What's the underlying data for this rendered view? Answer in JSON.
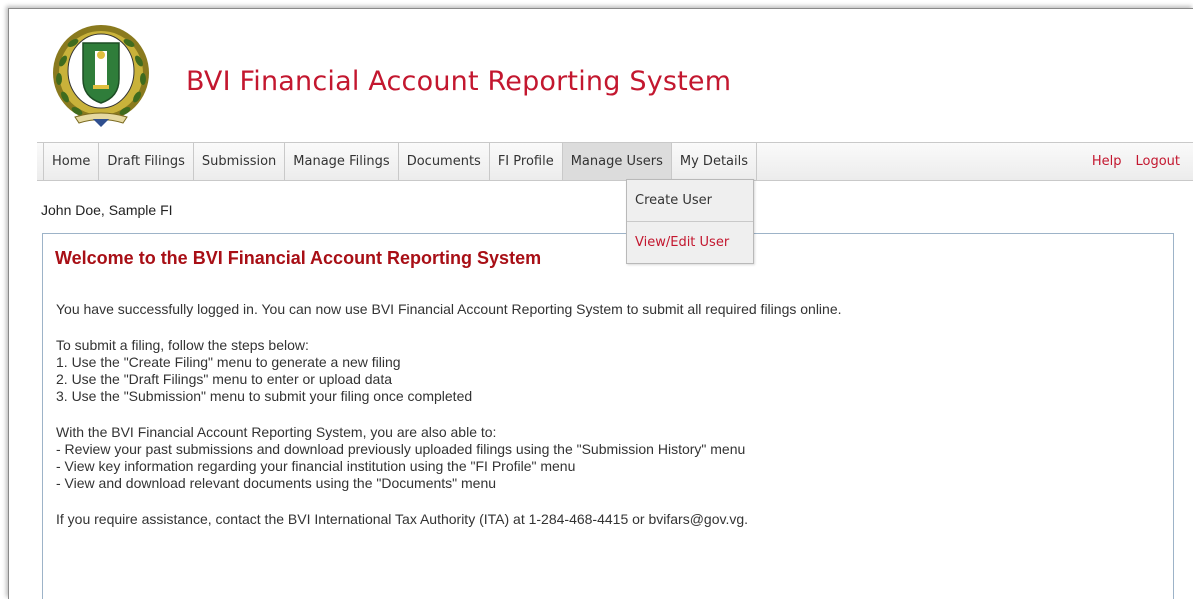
{
  "header": {
    "title": "BVI Financial Account Reporting System",
    "seal_icon": "bvi-coat-of-arms-icon"
  },
  "nav": {
    "items": [
      {
        "label": "Home"
      },
      {
        "label": "Draft Filings"
      },
      {
        "label": "Submission"
      },
      {
        "label": "Manage Filings"
      },
      {
        "label": "Documents"
      },
      {
        "label": "FI Profile"
      },
      {
        "label": "Manage Users"
      },
      {
        "label": "My Details"
      }
    ],
    "active": "Manage Users",
    "help": "Help",
    "logout": "Logout"
  },
  "dropdown": {
    "items": [
      {
        "label": "Create User"
      },
      {
        "label": "View/Edit User"
      }
    ]
  },
  "user": {
    "name": "John Doe, Sample FI"
  },
  "welcome": {
    "title": "Welcome to the BVI Financial Account Reporting System",
    "intro": "You have successfully logged in. You can now use BVI Financial Account Reporting System to submit all required filings online.",
    "steps_heading": "To submit a filing, follow the steps below:",
    "steps": [
      "1. Use the \"Create Filing\" menu to generate a new filing",
      "2. Use the \"Draft Filings\" menu to enter or upload data",
      "3. Use the \"Submission\" menu to submit your filing once completed"
    ],
    "features_heading": "With the BVI Financial Account Reporting System, you are also able to:",
    "features": [
      "- Review your past submissions and download previously uploaded filings using the \"Submission History\" menu",
      "- View key information regarding your financial institution using the \"FI Profile\" menu",
      "- View and download relevant documents using the \"Documents\" menu"
    ],
    "assistance": "If you require assistance, contact the BVI International Tax Authority (ITA) at 1-284-468-4415 or bvifars@gov.vg."
  },
  "colors": {
    "brand_red": "#c3172f",
    "title_red": "#a80f16",
    "panel_border": "#9db3c8"
  }
}
